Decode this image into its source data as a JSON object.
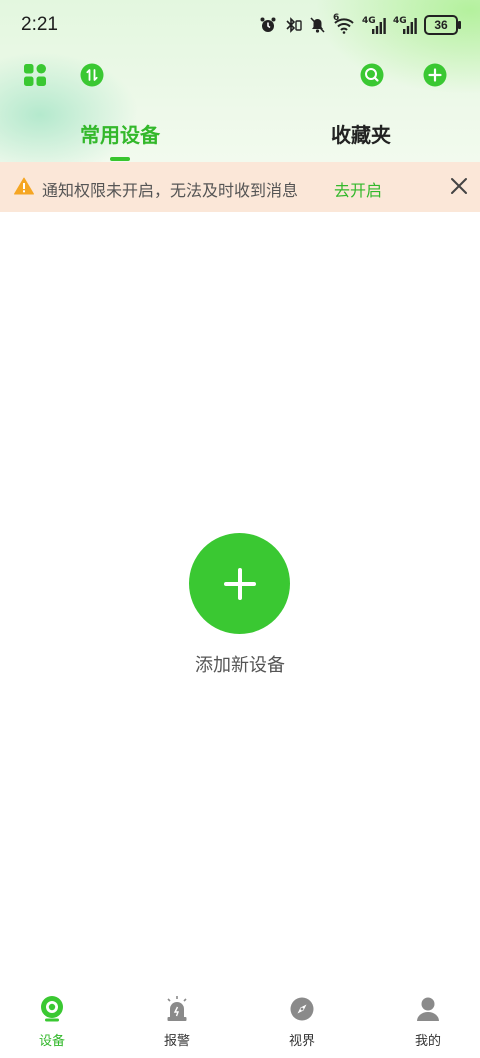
{
  "status_bar": {
    "time": "2:21",
    "battery": "36",
    "network_1": "4G",
    "network_2": "4G",
    "sim_indicator": "6"
  },
  "toolbar": {
    "left_icons": [
      "apps-grid-icon",
      "swap-icon"
    ],
    "right_icons": [
      "search-icon",
      "add-circle-icon"
    ]
  },
  "tabs": [
    {
      "label": "常用设备",
      "active": true
    },
    {
      "label": "收藏夹",
      "active": false
    }
  ],
  "notice": {
    "message": "通知权限未开启，无法及时收到消息",
    "action": "去开启"
  },
  "empty_state": {
    "add_label": "添加新设备"
  },
  "bottom_nav": [
    {
      "label": "设备",
      "icon": "camera-icon",
      "active": true
    },
    {
      "label": "报警",
      "icon": "alarm-siren-icon",
      "active": false
    },
    {
      "label": "视界",
      "icon": "compass-icon",
      "active": false
    },
    {
      "label": "我的",
      "icon": "profile-icon",
      "active": false
    }
  ],
  "colors": {
    "accent": "#38c52e",
    "notice_bg": "#fbe7d8",
    "warning": "#f5a623"
  }
}
